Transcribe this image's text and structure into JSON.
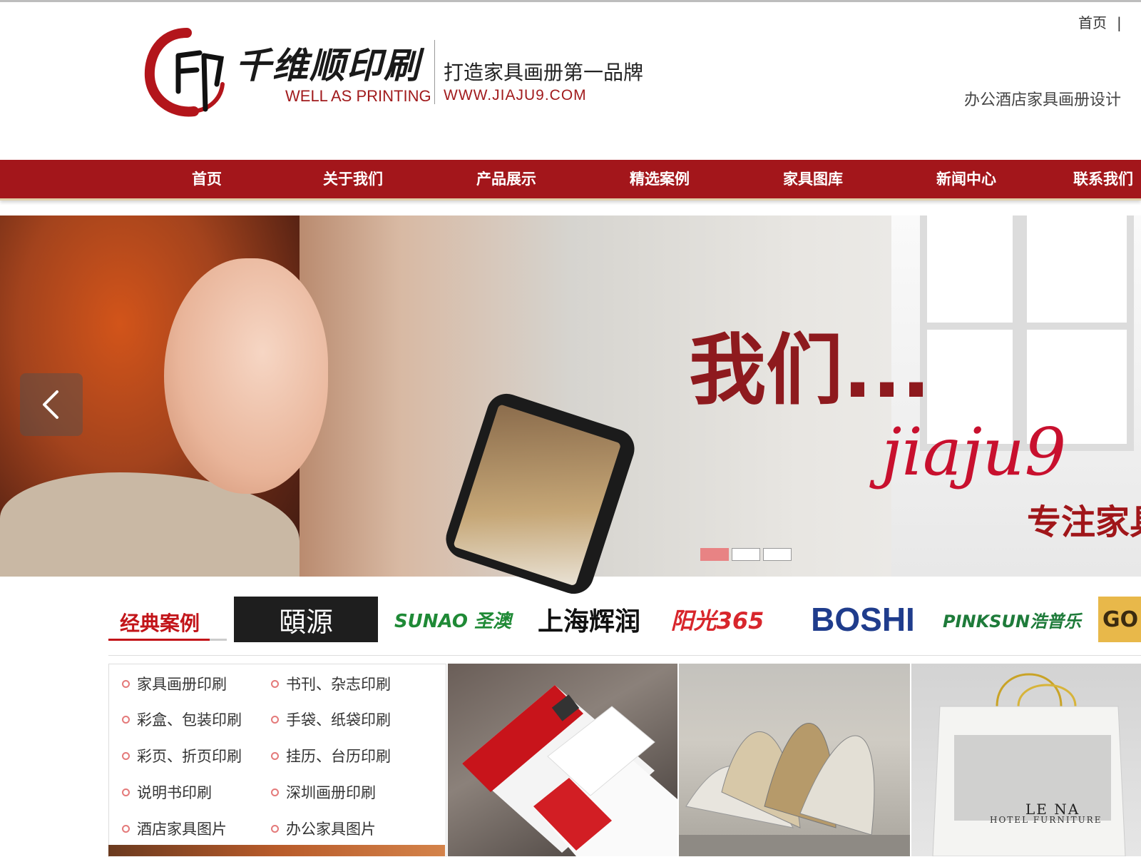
{
  "header": {
    "brand_cn": "千维顺印刷",
    "brand_en": "WELL AS PRINTING",
    "slogan": "打造家具画册第一品牌",
    "url": "WWW.JIAJU9.COM",
    "top_links": [
      "首页",
      "|"
    ],
    "tagline": "办公酒店家具画册设计"
  },
  "nav": {
    "items": [
      "首页",
      "关于我们",
      "产品展示",
      "精选案例",
      "家具图库",
      "新闻中心",
      "联系我们"
    ]
  },
  "banner": {
    "title": "我们...",
    "brand": "jiaju9",
    "subtitle": "专注家具",
    "slides_total": 3,
    "active_slide": 1
  },
  "cases": {
    "title": "经典案例",
    "logos": [
      "頤源",
      "SUNAO 圣澳",
      "上海辉润",
      "阳光365",
      "BOSHI",
      "PINKSUN浩普乐",
      "GO"
    ]
  },
  "categories": {
    "items": [
      "家具画册印刷",
      "书刊、杂志印刷",
      "彩盒、包装印刷",
      "手袋、纸袋印刷",
      "彩页、折页印刷",
      "挂历、台历印刷",
      "说明书印刷",
      "深圳画册印刷",
      "酒店家具图片",
      "办公家具图片"
    ]
  },
  "photos": {
    "bag_brand": "LE NA",
    "bag_sub": "HOTEL FURNITURE"
  },
  "colors": {
    "brand_red": "#a3161b",
    "accent_red": "#c21419"
  }
}
